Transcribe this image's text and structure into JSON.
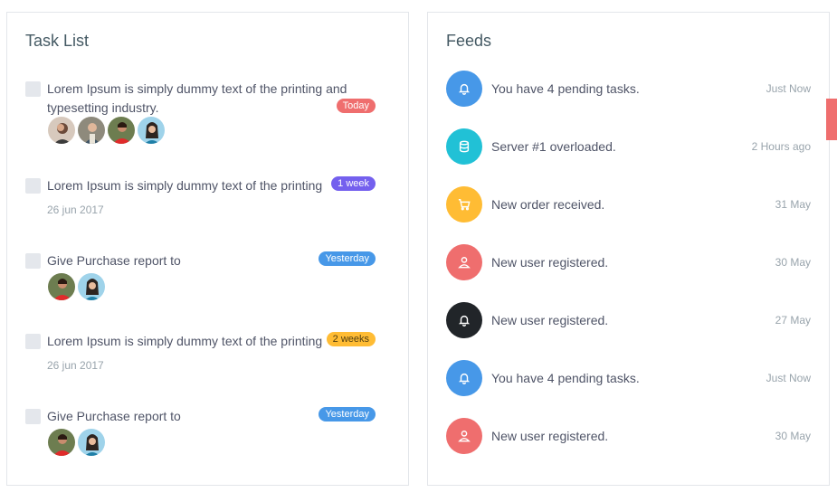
{
  "task_list": {
    "title": "Task List",
    "tasks": [
      {
        "text": "Lorem Ipsum is simply dummy text of the printing and typesetting industry.",
        "badge": "Today",
        "badge_color": "#ef6e6e",
        "date": "",
        "avatars": [
          "person-1",
          "person-2",
          "person-3",
          "person-4"
        ]
      },
      {
        "text": "Lorem Ipsum is simply dummy text of the printing",
        "badge": "1 week",
        "badge_color": "#7460ee",
        "date": "26 jun 2017",
        "avatars": []
      },
      {
        "text": "Give Purchase report to",
        "badge": "Yesterday",
        "badge_color": "#4798e8",
        "date": "",
        "avatars": [
          "person-3",
          "person-4"
        ]
      },
      {
        "text": "Lorem Ipsum is simply dummy text of the printing",
        "badge": "2 weeks",
        "badge_color": "#ffbc34",
        "date": "26 jun 2017",
        "avatars": []
      },
      {
        "text": "Give Purchase report to",
        "badge": "Yesterday",
        "badge_color": "#4798e8",
        "date": "",
        "avatars": [
          "person-3",
          "person-4"
        ]
      }
    ]
  },
  "feeds": {
    "title": "Feeds",
    "items": [
      {
        "icon": "bell-icon",
        "color": "#4798e8",
        "text": "You have 4 pending tasks.",
        "time": "Just Now"
      },
      {
        "icon": "database-icon",
        "color": "#21c1d6",
        "text": "Server #1 overloaded.",
        "time": "2 Hours ago"
      },
      {
        "icon": "cart-icon",
        "color": "#ffbc34",
        "text": "New order received.",
        "time": "31 May"
      },
      {
        "icon": "user-icon",
        "color": "#ef6e6e",
        "text": "New user registered.",
        "time": "30 May"
      },
      {
        "icon": "bell-icon",
        "color": "#212529",
        "text": "New user registered.",
        "time": "27 May"
      },
      {
        "icon": "bell-icon",
        "color": "#4798e8",
        "text": "You have 4 pending tasks.",
        "time": "Just Now"
      },
      {
        "icon": "user-icon",
        "color": "#ef6e6e",
        "text": "New user registered.",
        "time": "30 May"
      }
    ]
  },
  "colors": {
    "edge_tab": "#ef6e6e",
    "border": "#e3e6ea"
  }
}
